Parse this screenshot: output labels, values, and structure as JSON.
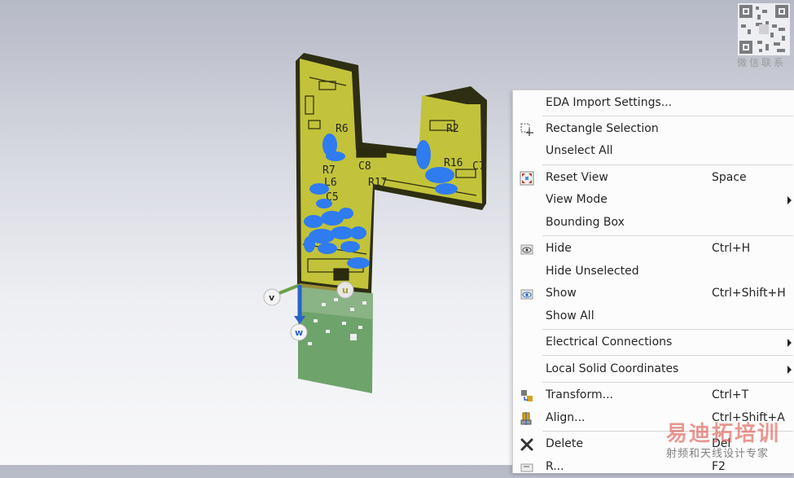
{
  "menu": {
    "items": [
      {
        "label": "EDA Import Settings...",
        "shortcut": "",
        "submenu": false,
        "icon": ""
      },
      {
        "label": "Rectangle Selection",
        "shortcut": "",
        "submenu": false,
        "icon": "rectangle-selection-icon"
      },
      {
        "label": "Unselect All",
        "shortcut": "",
        "submenu": false,
        "icon": ""
      },
      {
        "label": "Reset View",
        "shortcut": "Space",
        "submenu": false,
        "icon": "reset-view-icon"
      },
      {
        "label": "View Mode",
        "shortcut": "",
        "submenu": true,
        "icon": ""
      },
      {
        "label": "Bounding Box",
        "shortcut": "",
        "submenu": false,
        "icon": ""
      },
      {
        "label": "Hide",
        "shortcut": "Ctrl+H",
        "submenu": false,
        "icon": "hide-eye-icon"
      },
      {
        "label": "Hide Unselected",
        "shortcut": "",
        "submenu": false,
        "icon": ""
      },
      {
        "label": "Show",
        "shortcut": "Ctrl+Shift+H",
        "submenu": false,
        "icon": "show-eye-icon"
      },
      {
        "label": "Show All",
        "shortcut": "",
        "submenu": false,
        "icon": ""
      },
      {
        "label": "Electrical Connections",
        "shortcut": "",
        "submenu": true,
        "icon": ""
      },
      {
        "label": "Local Solid Coordinates",
        "shortcut": "",
        "submenu": true,
        "icon": ""
      },
      {
        "label": "Transform...",
        "shortcut": "Ctrl+T",
        "submenu": false,
        "icon": "transform-icon"
      },
      {
        "label": "Align...",
        "shortcut": "Ctrl+Shift+A",
        "submenu": false,
        "icon": "align-icon"
      },
      {
        "label": "Delete",
        "shortcut": "Del",
        "submenu": false,
        "icon": "delete-x-icon"
      },
      {
        "label": "R...",
        "shortcut": "F2",
        "submenu": false,
        "icon": "rename-icon"
      }
    ]
  },
  "axes": {
    "u": "u",
    "v": "v",
    "w": "w"
  },
  "pcb_labels": [
    "R6",
    "R7",
    "C8",
    "L6",
    "R17",
    "C5",
    "R16",
    "C7",
    "R2"
  ],
  "watermark": {
    "qr_caption": "微信联系",
    "brand": "易迪拓培训",
    "tagline": "射频和天线设计专家"
  },
  "colors": {
    "pcb": "#c2c33a",
    "field": "#2f7bf0",
    "ground": "#5f9a5c",
    "menu_bg": "#fcfcfc"
  }
}
